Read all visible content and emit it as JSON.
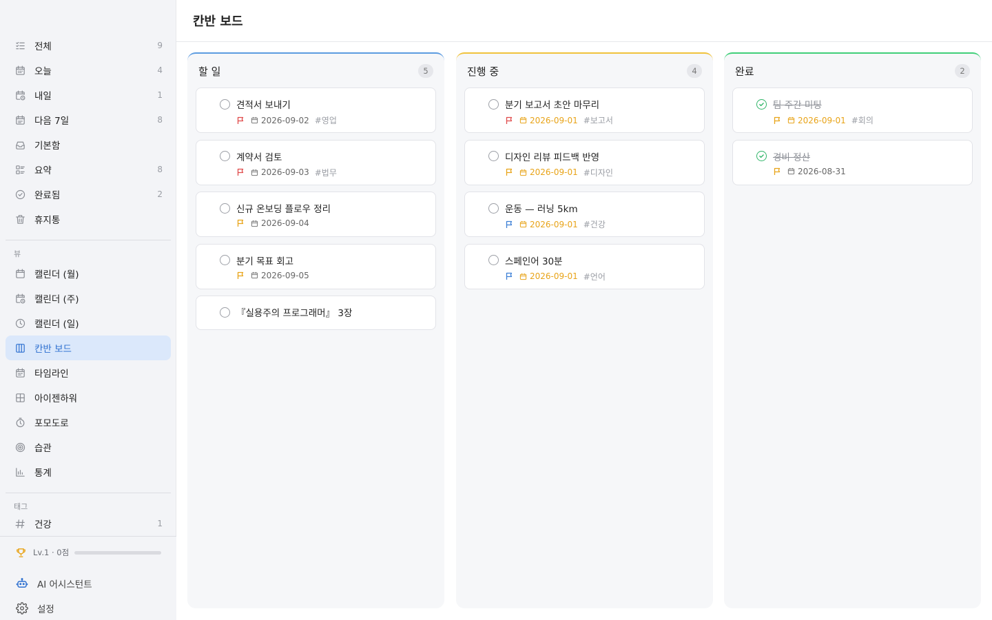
{
  "sidebar": {
    "smart_lists": [
      {
        "label": "전체",
        "count": "9",
        "icon": "list-check-icon"
      },
      {
        "label": "오늘",
        "count": "4",
        "icon": "calendar-today-icon"
      },
      {
        "label": "내일",
        "count": "1",
        "icon": "calendar-clock-icon"
      },
      {
        "label": "다음 7일",
        "count": "8",
        "icon": "calendar-week-icon"
      },
      {
        "label": "기본함",
        "count": "",
        "icon": "inbox-icon"
      },
      {
        "label": "요약",
        "count": "8",
        "icon": "summary-icon"
      },
      {
        "label": "완료됨",
        "count": "2",
        "icon": "check-circle-icon"
      },
      {
        "label": "휴지통",
        "count": "",
        "icon": "trash-icon"
      }
    ],
    "views_label": "뷰",
    "views": [
      {
        "label": "캘린더 (월)",
        "icon": "calendar-month-icon"
      },
      {
        "label": "캘린더 (주)",
        "icon": "calendar-week-view-icon"
      },
      {
        "label": "캘린더 (일)",
        "icon": "clock-icon"
      },
      {
        "label": "칸반 보드",
        "icon": "kanban-icon",
        "active": true
      },
      {
        "label": "타임라인",
        "icon": "timeline-icon"
      },
      {
        "label": "아이젠하워",
        "icon": "matrix-icon"
      },
      {
        "label": "포모도로",
        "icon": "timer-icon"
      },
      {
        "label": "습관",
        "icon": "target-icon"
      },
      {
        "label": "통계",
        "icon": "bar-chart-icon"
      }
    ],
    "tags_label": "태그",
    "tags": [
      {
        "label": "건강",
        "count": "1",
        "icon": "hash-icon"
      }
    ],
    "footer": {
      "level_text": "Lv.1 · 0점",
      "level_progress": 0.0,
      "assistant_label": "AI 어시스턴트",
      "settings_label": "설정"
    }
  },
  "header": {
    "title": "칸반 보드"
  },
  "colors": {
    "todo": "#5b9be0",
    "doing": "#f0c23b",
    "done": "#3fcf78",
    "flag_high": "#e04a4a",
    "flag_mid": "#e8a317",
    "flag_low": "#3c7fd6",
    "accent": "#2d6fd0"
  },
  "columns": [
    {
      "title": "할 일",
      "count": "5",
      "accent": "todo",
      "cards": [
        {
          "title": "견적서 보내기",
          "flag": "high",
          "date": "2026-09-02",
          "tag": "#영업",
          "due": false,
          "done": false
        },
        {
          "title": "계약서 검토",
          "flag": "high",
          "date": "2026-09-03",
          "tag": "#법무",
          "due": false,
          "done": false
        },
        {
          "title": "신규 온보딩 플로우 정리",
          "flag": "mid",
          "date": "2026-09-04",
          "tag": "",
          "due": false,
          "done": false
        },
        {
          "title": "분기 목표 회고",
          "flag": "mid",
          "date": "2026-09-05",
          "tag": "",
          "due": false,
          "done": false
        },
        {
          "title": "『실용주의 프로그래머』 3장",
          "flag": "",
          "date": "",
          "tag": "",
          "due": false,
          "done": false
        }
      ]
    },
    {
      "title": "진행 중",
      "count": "4",
      "accent": "doing",
      "cards": [
        {
          "title": "분기 보고서 초안 마무리",
          "flag": "high",
          "date": "2026-09-01",
          "tag": "#보고서",
          "due": true,
          "done": false
        },
        {
          "title": "디자인 리뷰 피드백 반영",
          "flag": "mid",
          "date": "2026-09-01",
          "tag": "#디자인",
          "due": true,
          "done": false
        },
        {
          "title": "운동 — 러닝 5km",
          "flag": "low",
          "date": "2026-09-01",
          "tag": "#건강",
          "due": true,
          "done": false
        },
        {
          "title": "스페인어 30분",
          "flag": "low",
          "date": "2026-09-01",
          "tag": "#언어",
          "due": true,
          "done": false
        }
      ]
    },
    {
      "title": "완료",
      "count": "2",
      "accent": "done",
      "cards": [
        {
          "title": "팀 주간 미팅",
          "flag": "mid",
          "date": "2026-09-01",
          "tag": "#회의",
          "due": true,
          "done": true
        },
        {
          "title": "경비 정산",
          "flag": "mid",
          "date": "2026-08-31",
          "tag": "",
          "due": false,
          "done": true
        }
      ]
    }
  ]
}
